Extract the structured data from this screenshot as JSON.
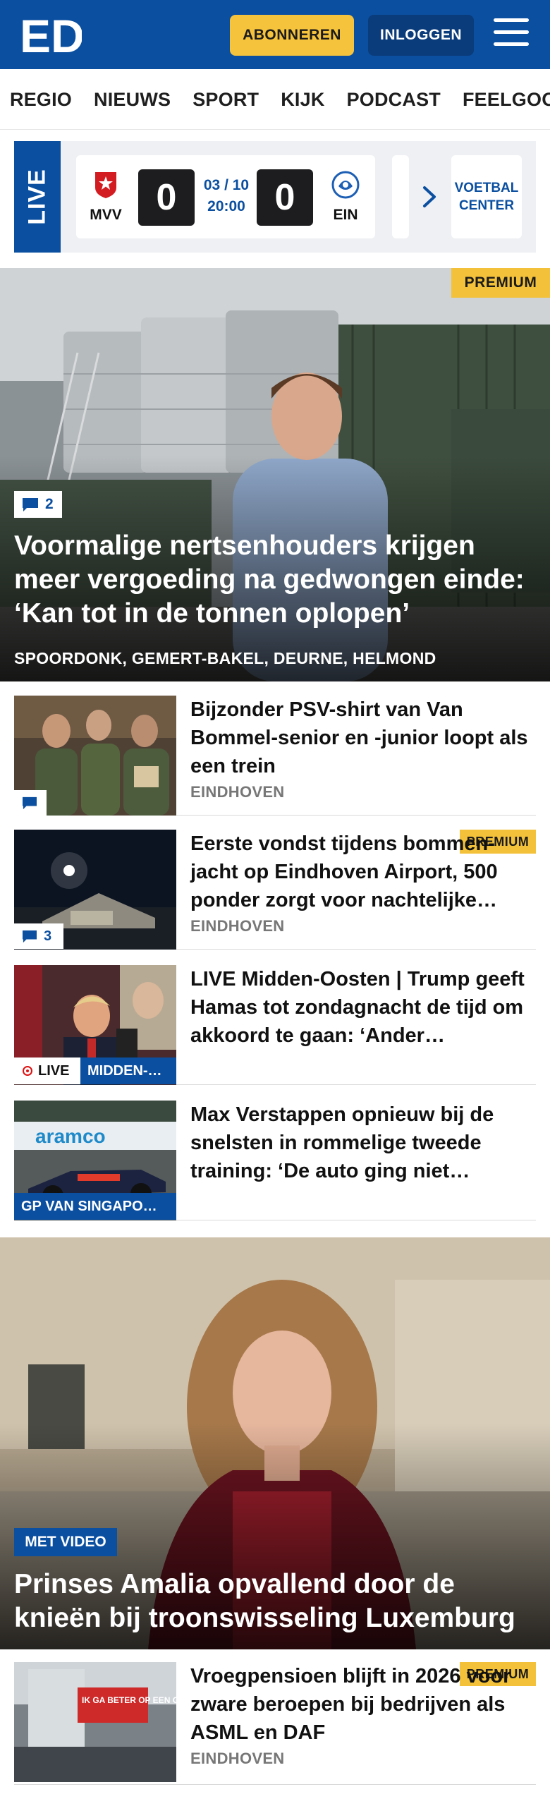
{
  "header": {
    "logo_text": "ED",
    "subscribe_label": "ABONNEREN",
    "login_label": "INLOGGEN"
  },
  "nav": {
    "items": [
      "REGIO",
      "NIEUWS",
      "SPORT",
      "KIJK",
      "PODCAST",
      "FEELGOOD"
    ]
  },
  "live_ticker": {
    "tab_label": "LIVE",
    "match": {
      "home_team": "MVV",
      "away_team": "EIN",
      "home_score": "0",
      "away_score": "0",
      "date": "03 / 10",
      "time": "20:00"
    },
    "voetbal_center_label": "VOETBAL CENTER"
  },
  "hero1": {
    "premium_label": "PREMIUM",
    "comment_count": "2",
    "title": "Voormalige nertsenhouders krijgen meer vergoeding na gedwongen einde: ‘Kan tot in de tonnen oplopen’",
    "location": "SPOORDONK, GEMERT-BAKEL, DEURNE, HELMOND"
  },
  "articles": [
    {
      "title": "Bijzonder PSV-shirt van Van Bommel-senior en -junior loopt als een trein",
      "location": "EINDHOVEN"
    },
    {
      "premium_label": "PREMIUM",
      "comment_count": "3",
      "title": "Eerste vondst tijdens bommen-jacht op Eindhoven Airport, 500 ponder zorgt voor nachtelijke…",
      "location": "EINDHOVEN"
    },
    {
      "live_label": "LIVE",
      "category": "MIDDEN-…",
      "title": "LIVE Midden-Oosten | Trump geeft Hamas tot zondagnacht de tijd om akkoord te gaan: ‘Ander…"
    },
    {
      "category": "GP VAN SINGAPO…",
      "title": "Max Verstappen opnieuw bij de snelsten in rommelige tweede training: ‘De auto ging niet…"
    }
  ],
  "hero2": {
    "video_label": "MET VIDEO",
    "title": "Prinses Amalia opvallend door de knieën bij troonswisseling Luxemburg"
  },
  "article_bottom": {
    "premium_label": "PREMIUM",
    "thumb_sign_text": "IK GA BETER OP EEN GOEDE",
    "title": "Vroegpensioen blijft in 2026 voor zware beroepen bij bedrijven als ASML en DAF",
    "location": "EINDHOVEN"
  },
  "colors": {
    "brand_blue": "#0b4fa0",
    "premium_yellow": "#f3c23a",
    "live_red": "#dd1111"
  }
}
